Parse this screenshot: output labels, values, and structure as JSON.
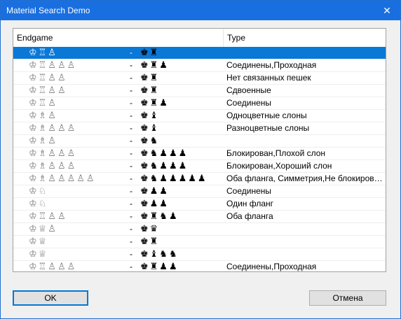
{
  "window": {
    "title": "Material Search Demo",
    "close_glyph": "✕"
  },
  "columns": {
    "endgame": "Endgame",
    "type": "Type"
  },
  "rows": [
    {
      "white": "♔♖♙",
      "dash": "-",
      "black": "♚♜",
      "type": "",
      "selected": true
    },
    {
      "white": "♔♖♙♙♙",
      "dash": "-",
      "black": "♚♜♟",
      "type": "Соединены,Проходная"
    },
    {
      "white": "♔♖♙♙",
      "dash": "-",
      "black": "♚♜",
      "type": "Нет связанных пешек"
    },
    {
      "white": "♔♖♙♙",
      "dash": "-",
      "black": "♚♜",
      "type": "Сдвоенные"
    },
    {
      "white": "♔♖♙",
      "dash": "-",
      "black": "♚♜♟",
      "type": "Соединены"
    },
    {
      "white": "♔♗♙",
      "dash": "-",
      "black": "♚♝",
      "type": "Одноцветные слоны"
    },
    {
      "white": "♔♗♙♙♙",
      "dash": "-",
      "black": "♚♝",
      "type": "Разноцветные слоны"
    },
    {
      "white": "♔♗♙",
      "dash": "-",
      "black": "♚♞",
      "type": ""
    },
    {
      "white": "♔♗♙♙♙",
      "dash": "-",
      "black": "♚♞♟♟♟",
      "type": "Блокирован,Плохой слон"
    },
    {
      "white": "♔♗♙♙♙",
      "dash": "-",
      "black": "♚♞♟♟♟",
      "type": "Блокирован,Хороший слон"
    },
    {
      "white": "♔♗♙♙♙♙♙",
      "dash": "-",
      "black": "♚♞♟♟♟♟♟",
      "type": "Оба фланга, Симметрия,Не блокиров…"
    },
    {
      "white": "♔♘",
      "dash": "-",
      "black": "♚♟♟",
      "type": "Соединены"
    },
    {
      "white": "♔♘",
      "dash": "-",
      "black": "♚♟♟",
      "type": "Один фланг"
    },
    {
      "white": "♔♖♙♙",
      "dash": "-",
      "black": "♚♜♞♟",
      "type": "Оба фланга"
    },
    {
      "white": "♔♕♙",
      "dash": "-",
      "black": "♚♛",
      "type": ""
    },
    {
      "white": "♔♕",
      "dash": "-",
      "black": "♚♜",
      "type": ""
    },
    {
      "white": "♔♕",
      "dash": "-",
      "black": "♚♝♞♞",
      "type": ""
    },
    {
      "white": "♔♖♙♙♙",
      "dash": "-",
      "black": "♚♜♟♟",
      "type": "Соединены,Проходная"
    }
  ],
  "buttons": {
    "ok": "OK",
    "cancel": "Отмена"
  },
  "colors": {
    "titlebar": "#1a6fe0",
    "selection": "#0a78d7"
  }
}
